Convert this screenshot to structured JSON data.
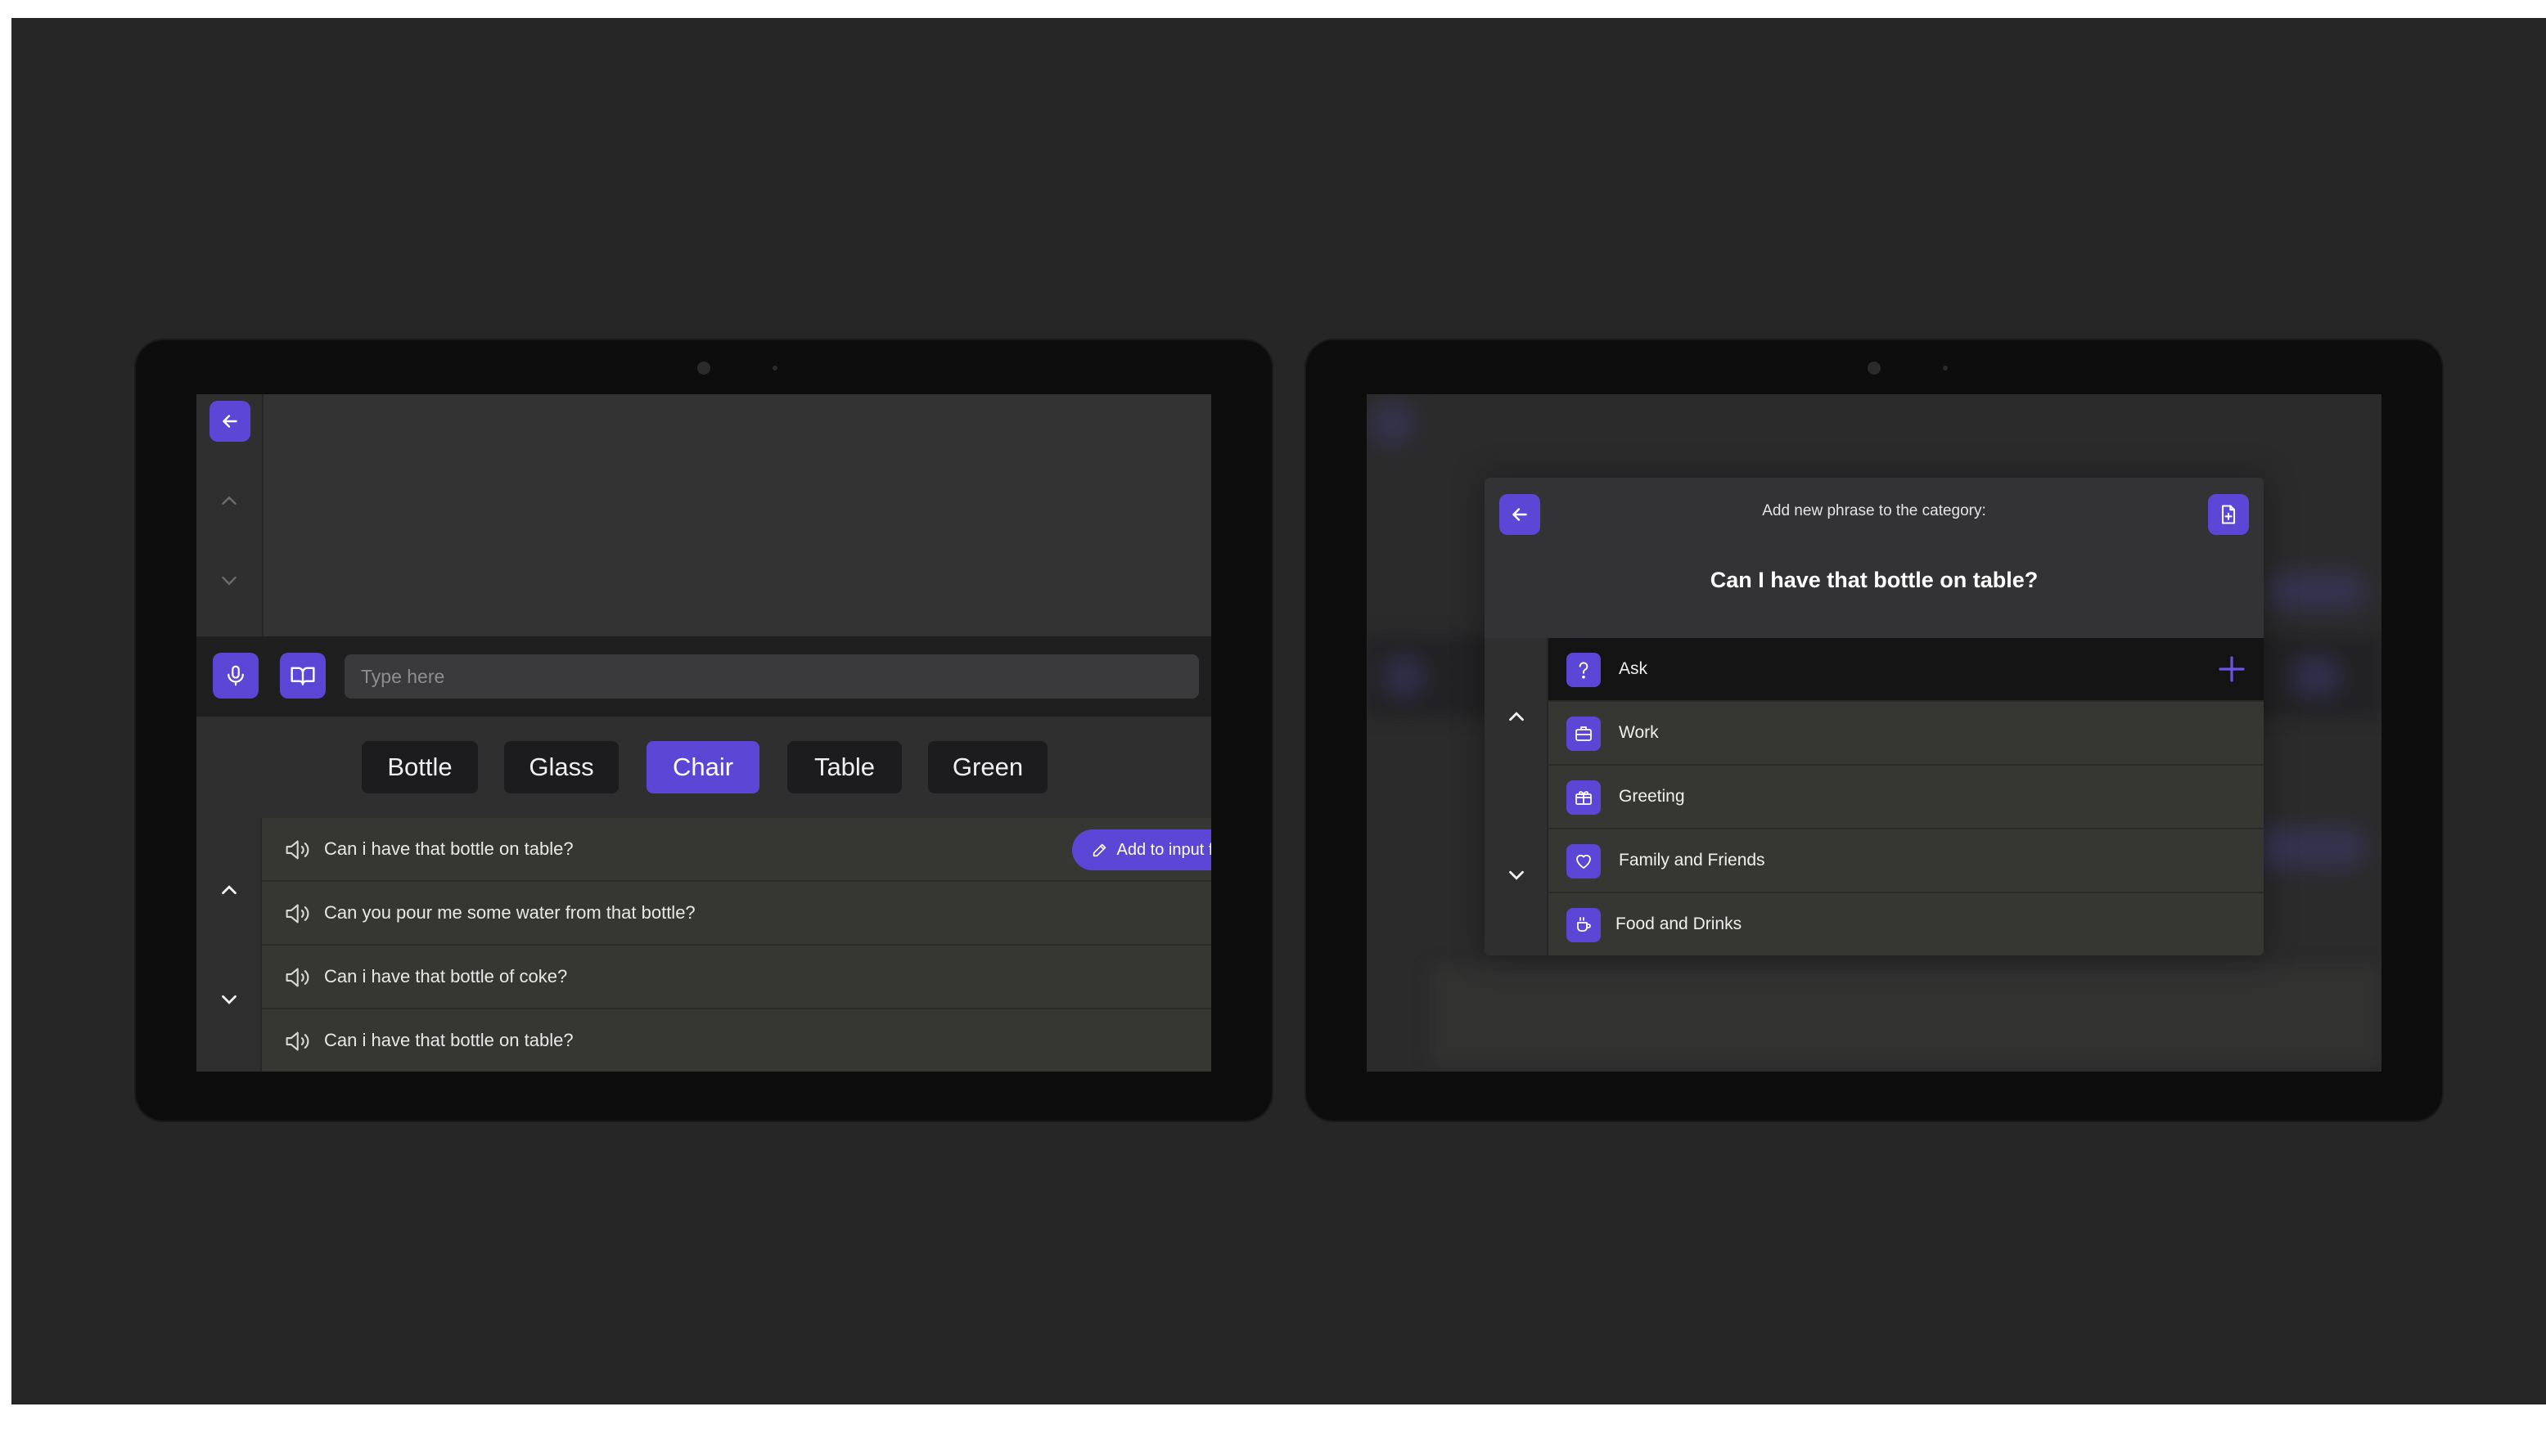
{
  "left_screen": {
    "input_placeholder": "Type here",
    "word_chips": [
      {
        "label": "Bottle",
        "active": false
      },
      {
        "label": "Glass",
        "active": false
      },
      {
        "label": "Chair",
        "active": true
      },
      {
        "label": "Table",
        "active": false
      },
      {
        "label": "Green",
        "active": false
      }
    ],
    "phrases": [
      "Can i have that bottle on table?",
      "Can you pour me some water from that bottle?",
      "Can i have that bottle of coke?",
      "Can i have that bottle on table?"
    ],
    "add_button_label": "Add to input field",
    "icons": [
      "back-arrow-icon",
      "chevron-up-icon",
      "chevron-down-icon",
      "microphone-icon",
      "book-icon",
      "speaker-icon",
      "pencil-icon"
    ]
  },
  "right_screen": {
    "modal_label": "Add new phrase to the category:",
    "phrase": "Can I have that bottle on table?",
    "categories": [
      {
        "label": "Ask",
        "icon": "question-icon",
        "selected": true
      },
      {
        "label": "Work",
        "icon": "briefcase-icon",
        "selected": false
      },
      {
        "label": "Greeting",
        "icon": "gift-icon",
        "selected": false
      },
      {
        "label": "Family and Friends",
        "icon": "heart-icon",
        "selected": false
      },
      {
        "label": "Food and Drinks",
        "icon": "cup-icon",
        "selected": false
      }
    ],
    "icons": [
      "back-arrow-icon",
      "document-add-icon",
      "plus-icon",
      "chevron-up-icon",
      "chevron-down-icon"
    ]
  },
  "colors": {
    "accent": "#5b46d6",
    "canvas": "#262626",
    "device": "#0d0d0d",
    "screen": "#2f2f30",
    "row": "#363633",
    "selected_row": "#141414"
  }
}
